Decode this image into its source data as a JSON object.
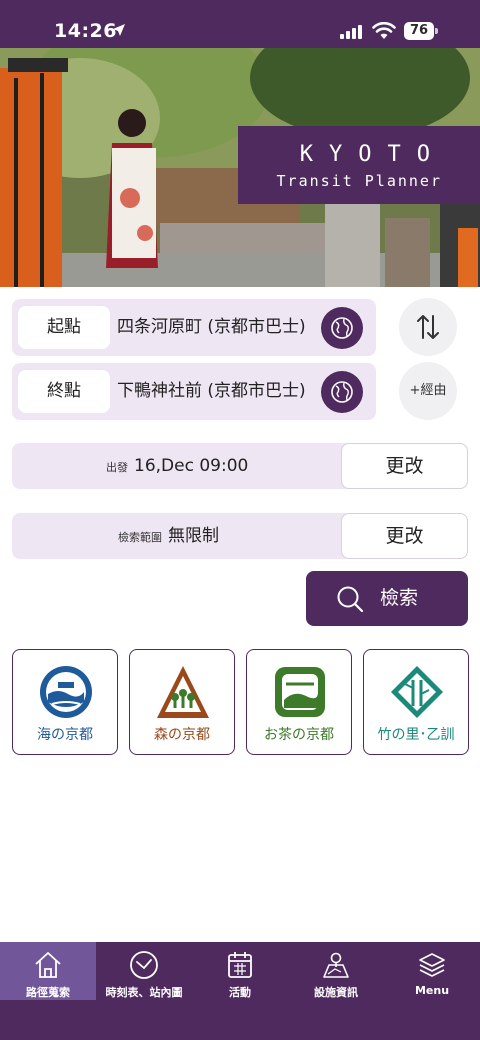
{
  "status_bar": {
    "time": "14:26",
    "battery": "76"
  },
  "hero": {
    "title": "KYOTO",
    "subtitle": "Transit Planner"
  },
  "route": {
    "origin": {
      "tag": "起點",
      "station": "四条河原町 (京都市巴士)"
    },
    "destination": {
      "tag": "終點",
      "station": "下鴨神社前 (京都市巴士)"
    },
    "via_label": "+經由"
  },
  "departure": {
    "label": "出發",
    "value": "16,Dec 09:00",
    "change_label": "更改"
  },
  "search_range": {
    "label": "檢索範圍",
    "value": "無限制",
    "change_label": "更改"
  },
  "search_button": {
    "label": "檢索"
  },
  "regions": [
    {
      "label": "海の京都",
      "color": "#1f5a9a"
    },
    {
      "label": "森の京都",
      "color": "#9a4a1a"
    },
    {
      "label": "お茶の京都",
      "color": "#3d7a2a"
    },
    {
      "label": "竹の里･乙訓",
      "color": "#1a8a7a"
    }
  ],
  "bottom_nav": [
    {
      "label": "路徑蒐索",
      "icon": "home-icon",
      "active": true
    },
    {
      "label": "時刻表、站內圖",
      "icon": "clock-icon",
      "active": false
    },
    {
      "label": "活動",
      "icon": "calendar-icon",
      "active": false
    },
    {
      "label": "設施資訊",
      "icon": "map-pin-icon",
      "active": false
    },
    {
      "label": "Menu",
      "icon": "layers-icon",
      "active": false
    }
  ],
  "colors": {
    "primary": "#4f2a5e",
    "row_bg": "#efe6f3",
    "nav_active": "#72569a"
  }
}
